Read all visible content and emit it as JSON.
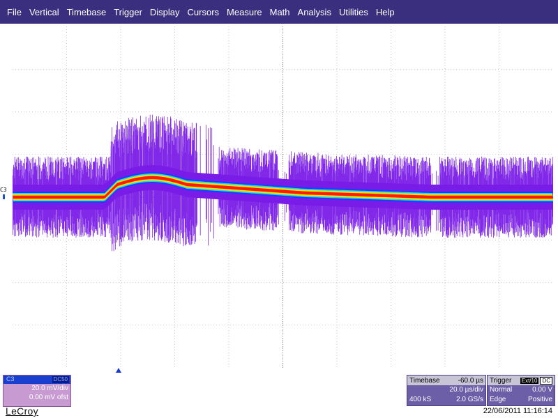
{
  "menu": [
    "File",
    "Vertical",
    "Timebase",
    "Trigger",
    "Display",
    "Cursors",
    "Measure",
    "Math",
    "Analysis",
    "Utilities",
    "Help"
  ],
  "channel": {
    "label": "C3",
    "header_tag": "DC50",
    "volts_div": "20.0 mV/div",
    "offset": "0.00 mV ofst"
  },
  "timebase": {
    "title": "Timebase",
    "delay": "-60.0 µs",
    "time_div": "20.0 µs/div",
    "samples": "400 kS",
    "rate": "2.0 GS/s"
  },
  "trigger": {
    "title": "Trigger",
    "source": "Ext/10",
    "coupling": "DC",
    "mode": "Normal",
    "level": "0.00 V",
    "type": "Edge",
    "slope": "Positive"
  },
  "brand": "LeCroy",
  "datetime": "22/06/2011 11:16:14",
  "colors": {
    "menubar": "#3a2f7e",
    "trace_outer": "#7a1ce8",
    "trace_mid": "#1fd0ff",
    "trace_core": "#ff1a00",
    "grid": "#9a9a9a"
  }
}
